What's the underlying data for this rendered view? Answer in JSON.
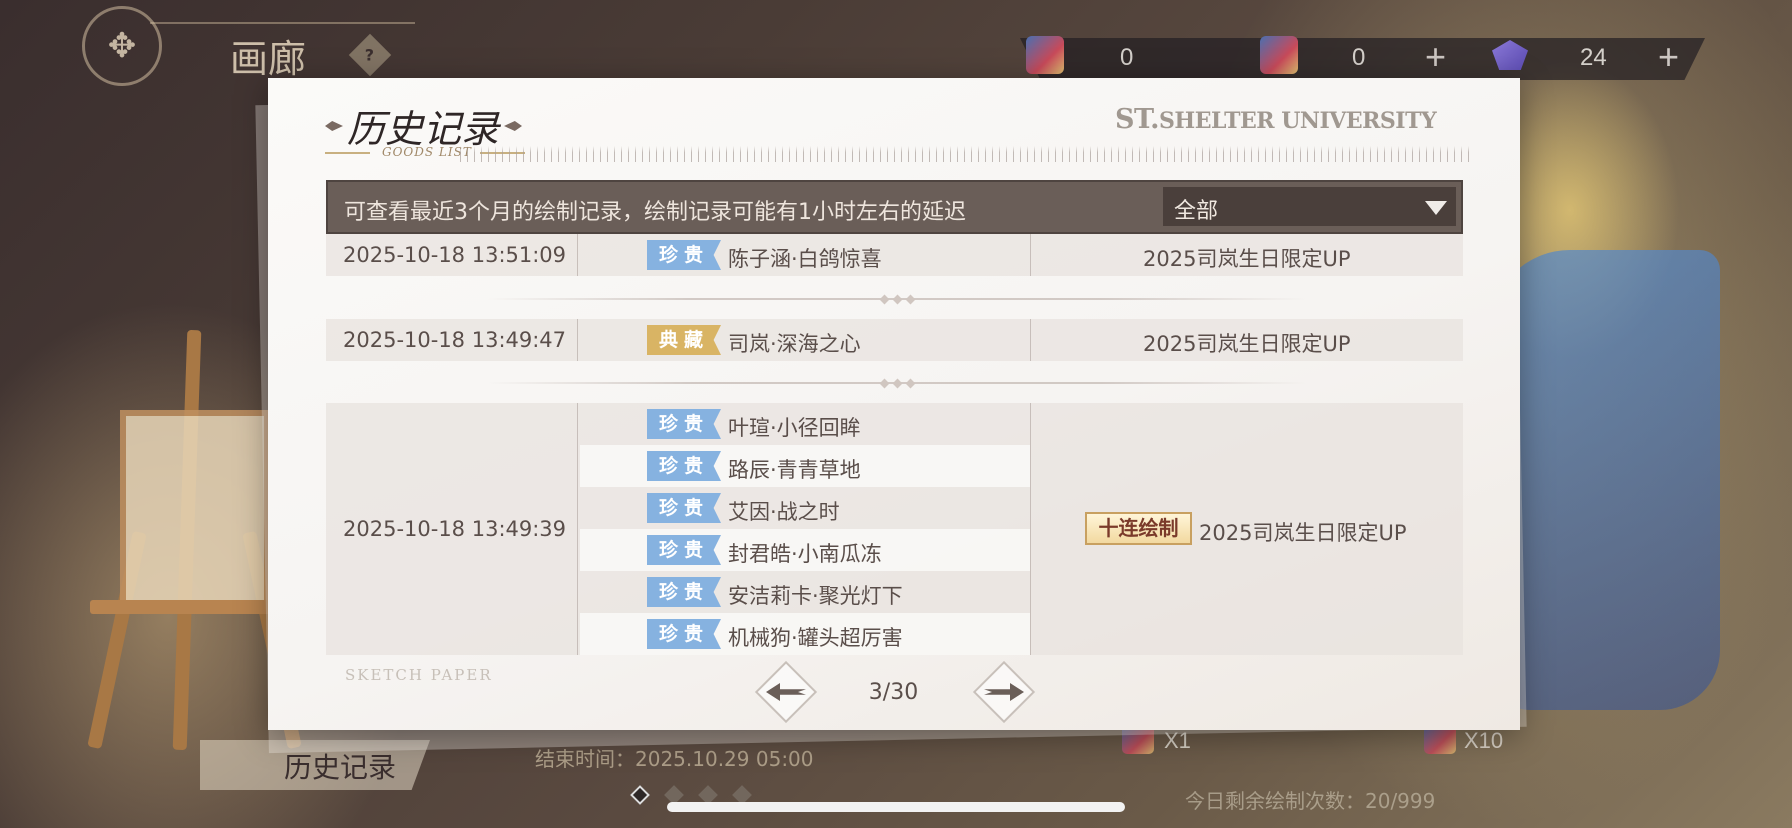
{
  "screen": {
    "gallery_title": "画廊",
    "gallery_help": "?",
    "currencies": [
      {
        "name": "draw-ticket",
        "value": "0"
      },
      {
        "name": "draw-ticket-b",
        "value": "0"
      },
      {
        "name": "gem",
        "value": "24"
      }
    ],
    "history_tab": "历史记录",
    "end_time": "结束时间：2025.10.29  05:00",
    "draw_x1": "X1",
    "draw_x10": "X10",
    "remaining": "今日剩余绘制次数：20/999"
  },
  "modal": {
    "title": "历史记录",
    "subtitle": "GOODS LIST",
    "brand_st": "ST.",
    "brand_rest": "SHELTER UNIVERSITY",
    "notice": "可查看最近3个月的绘制记录，绘制记录可能有1小时左右的延迟",
    "filter": {
      "selected": "全部"
    },
    "records": [
      {
        "time": "2025-10-18  13:51:09",
        "pool": "2025司岚生日限定UP",
        "ten": "",
        "items": [
          {
            "rarity": "珍贵",
            "name": "陈子涵·白鸽惊喜"
          }
        ]
      },
      {
        "time": "2025-10-18  13:49:47",
        "pool": "2025司岚生日限定UP",
        "ten": "",
        "items": [
          {
            "rarity": "典藏",
            "name": "司岚·深海之心"
          }
        ]
      },
      {
        "time": "2025-10-18  13:49:39",
        "pool": "2025司岚生日限定UP",
        "ten": "十连绘制",
        "items": [
          {
            "rarity": "珍贵",
            "name": "叶瑄·小径回眸"
          },
          {
            "rarity": "珍贵",
            "name": "路辰·青青草地"
          },
          {
            "rarity": "珍贵",
            "name": "艾因·战之时"
          },
          {
            "rarity": "珍贵",
            "name": "封君皓·小南瓜冻"
          },
          {
            "rarity": "珍贵",
            "name": "安洁莉卡·聚光灯下"
          },
          {
            "rarity": "珍贵",
            "name": "机械狗·罐头超厉害"
          }
        ]
      }
    ],
    "footer_mark": "SKETCH PAPER",
    "pager": "3/30"
  },
  "colors": {
    "rare_tag": "#86b2e0",
    "collection_tag": "#d9b464",
    "filter_bar": "#6a5e58"
  }
}
